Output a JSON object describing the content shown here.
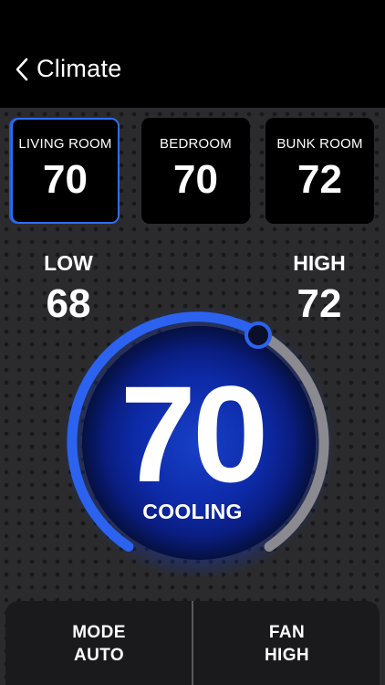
{
  "header": {
    "title": "Climate"
  },
  "zones": [
    {
      "name": "LIVING ROOM",
      "temp": "70"
    },
    {
      "name": "BEDROOM",
      "temp": "70"
    },
    {
      "name": "BUNK ROOM",
      "temp": "72"
    }
  ],
  "setpoints": {
    "low_label": "LOW",
    "low_value": "68",
    "high_label": "HIGH",
    "high_value": "72"
  },
  "dial": {
    "temperature": "70",
    "status": "COOLING"
  },
  "controls": {
    "mode_label": "MODE",
    "mode_value": "AUTO",
    "fan_label": "FAN",
    "fan_value": "HIGH"
  },
  "colors": {
    "accent": "#2f6ff0",
    "track": "#8a8a90",
    "background": "#2a2a2d"
  }
}
